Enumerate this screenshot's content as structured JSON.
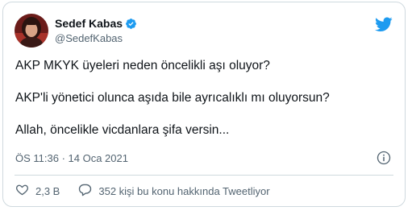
{
  "tweet": {
    "author": {
      "display_name": "Sedef Kabas",
      "handle": "@SedefKabas",
      "verified": true,
      "avatar_icon": "profile-photo"
    },
    "platform_icon": "twitter-bird-icon",
    "brand_color": "#1d9bf0",
    "paragraphs": [
      "AKP MKYK üyeleri neden öncelikli aşı oluyor?",
      "AKP'li yönetici olunca aşıda bile ayrıcalıklı mı oluyorsun?",
      "Allah, öncelikle vicdanlara şifa versin..."
    ],
    "timestamp": "ÖS 11:36 · 14 Oca 2021",
    "info_icon": "info-icon",
    "likes": {
      "icon": "heart-icon",
      "count": "2,3 B"
    },
    "replies": {
      "icon": "speech-bubble-icon",
      "label": "352 kişi bu konu hakkında Tweetliyor"
    }
  }
}
